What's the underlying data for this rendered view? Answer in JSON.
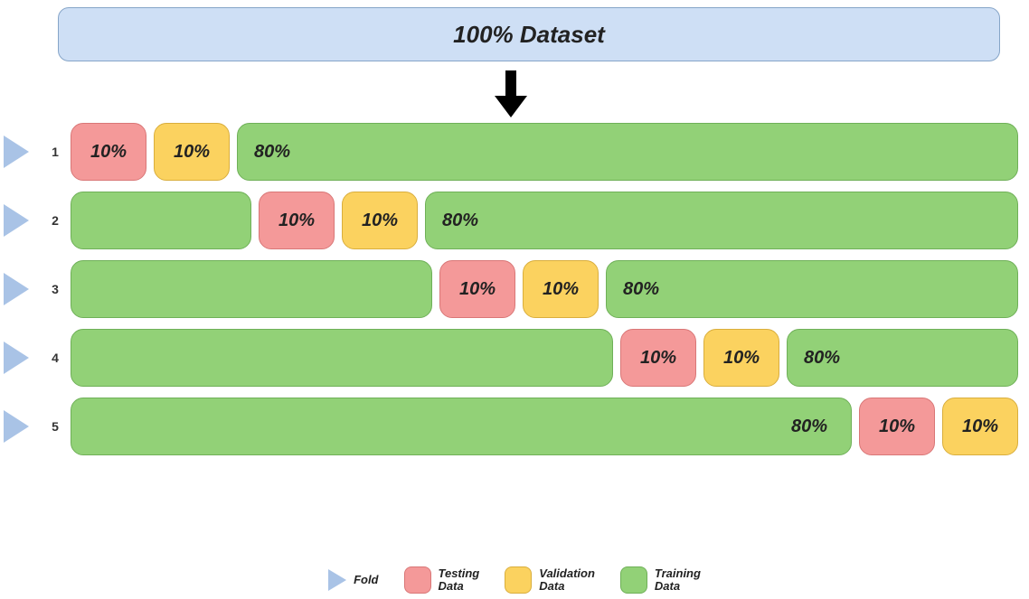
{
  "title": "100% Dataset",
  "percent": {
    "test": "10%",
    "valid": "10%",
    "train": "80%"
  },
  "folds": {
    "n1": "1",
    "n2": "2",
    "n3": "3",
    "n4": "4",
    "n5": "5"
  },
  "legend": {
    "fold": "Fold",
    "testing": "Testing\nData",
    "validation": "Validation\nData",
    "training": "Training\nData"
  },
  "chart_data": {
    "type": "table",
    "title": "5-Fold Cross-Validation Data Split",
    "columns": [
      "Fold",
      "Testing Data %",
      "Validation Data %",
      "Training Data %"
    ],
    "rows": [
      {
        "fold": 1,
        "testing": 10,
        "validation": 10,
        "training": 80
      },
      {
        "fold": 2,
        "testing": 10,
        "validation": 10,
        "training": 80
      },
      {
        "fold": 3,
        "testing": 10,
        "validation": 10,
        "training": 80
      },
      {
        "fold": 4,
        "testing": 10,
        "validation": 10,
        "training": 80
      },
      {
        "fold": 5,
        "testing": 10,
        "validation": 10,
        "training": 80
      }
    ],
    "total_percent": 100
  }
}
